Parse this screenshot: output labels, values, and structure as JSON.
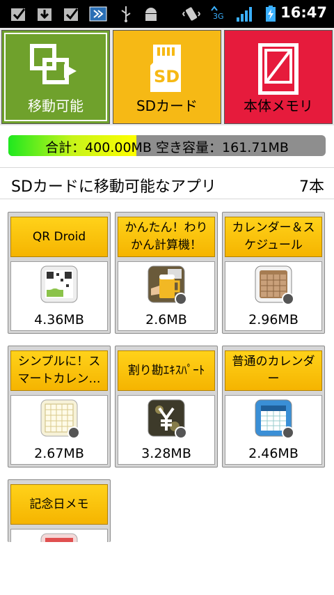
{
  "status_bar": {
    "time": "16:47",
    "icons": [
      "check-notification-icon",
      "download-icon",
      "check-notification-icon",
      "app-notification-icon",
      "usb-icon",
      "android-debug-icon",
      "vibrate-icon",
      "3g-data-icon",
      "signal-icon",
      "battery-charging-icon"
    ]
  },
  "tabs": [
    {
      "label": "移動可能",
      "icon": "move-apps-icon"
    },
    {
      "label": "SDカード",
      "icon": "sd-card-icon"
    },
    {
      "label": "本体メモリ",
      "icon": "phone-memory-icon"
    }
  ],
  "storage": {
    "text": "合計：400.00MB  空き容量：161.71MB",
    "free_fraction": 0.5957
  },
  "section": {
    "title": "SDカードに移動可能なアプリ",
    "count": "7本"
  },
  "apps": [
    {
      "name": "QR Droid",
      "size": "4.36MB",
      "icon": "qr-droid-icon"
    },
    {
      "name": "かんたん！わりかん計算機！",
      "size": "2.6MB",
      "icon": "beer-calculator-icon"
    },
    {
      "name": "カレンダー＆スケジュール",
      "size": "2.96MB",
      "icon": "calendar-book-icon"
    },
    {
      "name": "シンプルに！スマートカレン…",
      "size": "2.67MB",
      "icon": "simple-calendar-icon"
    },
    {
      "name": "割り勘ｴｷｽﾊﾟｰﾄ",
      "size": "3.28MB",
      "icon": "yen-icon"
    },
    {
      "name": "普通のカレンダー",
      "size": "2.46MB",
      "icon": "blue-calendar-icon"
    },
    {
      "name": "記念日メモ",
      "size": "",
      "icon": "anniversary-memo-icon"
    }
  ],
  "colors": {
    "tab_move": "#6fa12c",
    "tab_sd": "#f6b915",
    "tab_body": "#e61b3c",
    "card_name_bg": "#f5b400"
  }
}
